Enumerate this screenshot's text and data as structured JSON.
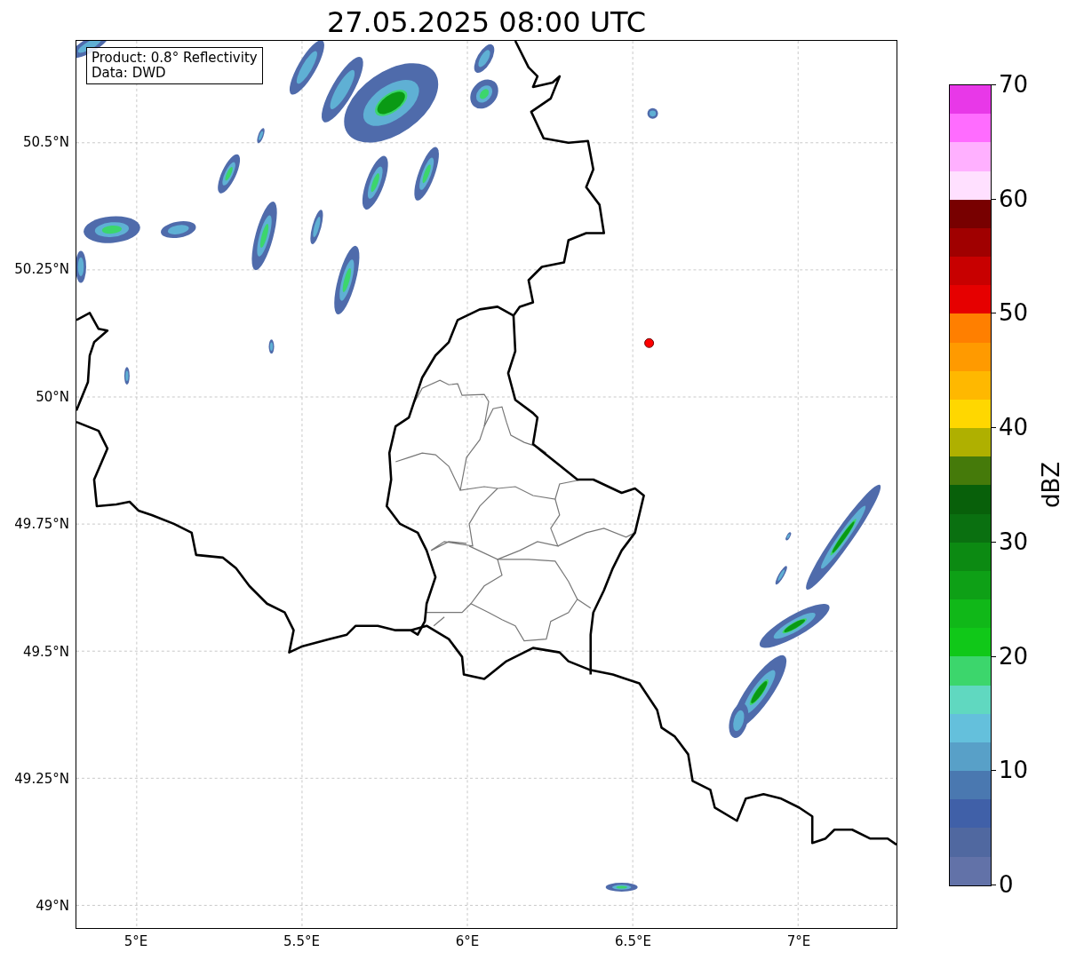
{
  "title": "27.05.2025 08:00 UTC",
  "info_box": [
    "Product: 0.8° Reflectivity",
    "Data: DWD"
  ],
  "map": {
    "y_ticks": [
      "50.5°N",
      "50.25°N",
      "50°N",
      "49.75°N",
      "49.5°N",
      "49.25°N",
      "49°N"
    ],
    "x_ticks": [
      "5°E",
      "5.5°E",
      "6°E",
      "6.5°E",
      "7°E"
    ]
  },
  "colorbar": {
    "label": "dBZ",
    "ticks": [
      "70",
      "60",
      "50",
      "40",
      "30",
      "20",
      "10",
      "0"
    ],
    "segments": [
      {
        "color": "#e838e8"
      },
      {
        "color": "#ff6cff"
      },
      {
        "color": "#ffb0ff"
      },
      {
        "color": "#ffe0ff"
      },
      {
        "color": "#780000"
      },
      {
        "color": "#a00000"
      },
      {
        "color": "#c80000"
      },
      {
        "color": "#e60000"
      },
      {
        "color": "#ff7f00"
      },
      {
        "color": "#ff9a00"
      },
      {
        "color": "#ffb800"
      },
      {
        "color": "#ffd700"
      },
      {
        "color": "#afb000"
      },
      {
        "color": "#457a0a"
      },
      {
        "color": "#08600a"
      },
      {
        "color": "#0a7010"
      },
      {
        "color": "#0c8a12"
      },
      {
        "color": "#0ea016"
      },
      {
        "color": "#10b818"
      },
      {
        "color": "#10c818"
      },
      {
        "color": "#3cd66c"
      },
      {
        "color": "#60d8c0"
      },
      {
        "color": "#64c0dc"
      },
      {
        "color": "#58a0c8"
      },
      {
        "color": "#4a78b0"
      },
      {
        "color": "#4060a8"
      },
      {
        "color": "#5068a0"
      },
      {
        "color": "#6272a8"
      }
    ]
  }
}
